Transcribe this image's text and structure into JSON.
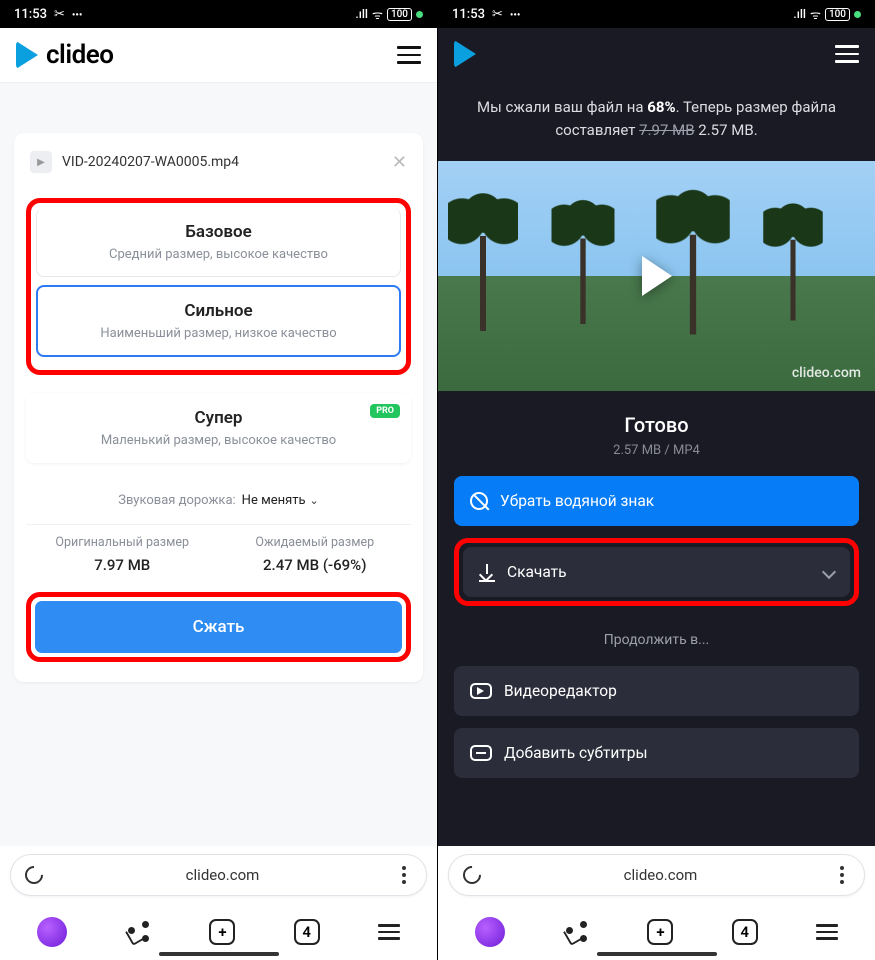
{
  "status": {
    "time": "11:53",
    "battery": "100"
  },
  "brand": {
    "name": "clideo",
    "watermark_domain": "clideo.com"
  },
  "left": {
    "file_name": "VID-20240207-WA0005.mp4",
    "options": [
      {
        "title": "Базовое",
        "sub": "Средний размер, высокое качество"
      },
      {
        "title": "Сильное",
        "sub": "Наименьший размер, низкое качество"
      },
      {
        "title": "Супер",
        "sub": "Маленький размер, высокое качество",
        "pro": "PRO"
      }
    ],
    "audio_label": "Звуковая дорожка:",
    "audio_value": "Не менять",
    "size_orig_label": "Оригинальный размер",
    "size_orig_value": "7.97 MB",
    "size_exp_label": "Ожидаемый размер",
    "size_exp_value": "2.47 MB (-69%)",
    "compress_btn": "Сжать"
  },
  "right": {
    "msg_prefix": "Мы сжали ваш файл на ",
    "msg_percent": "68%",
    "msg_mid": ". Теперь размер файла составляет ",
    "msg_old": "7.97 MB",
    "msg_new": " 2.57 MB.",
    "ready_title": "Готово",
    "ready_sub": "2.57 MB  /  MP4",
    "remove_wm": "Убрать водяной знак",
    "download": "Скачать",
    "continue_in": "Продолжить в...",
    "editor": "Видеоредактор",
    "subtitles": "Добавить субтитры"
  },
  "browser": {
    "url": "clideo.com",
    "tab_count": "4"
  }
}
